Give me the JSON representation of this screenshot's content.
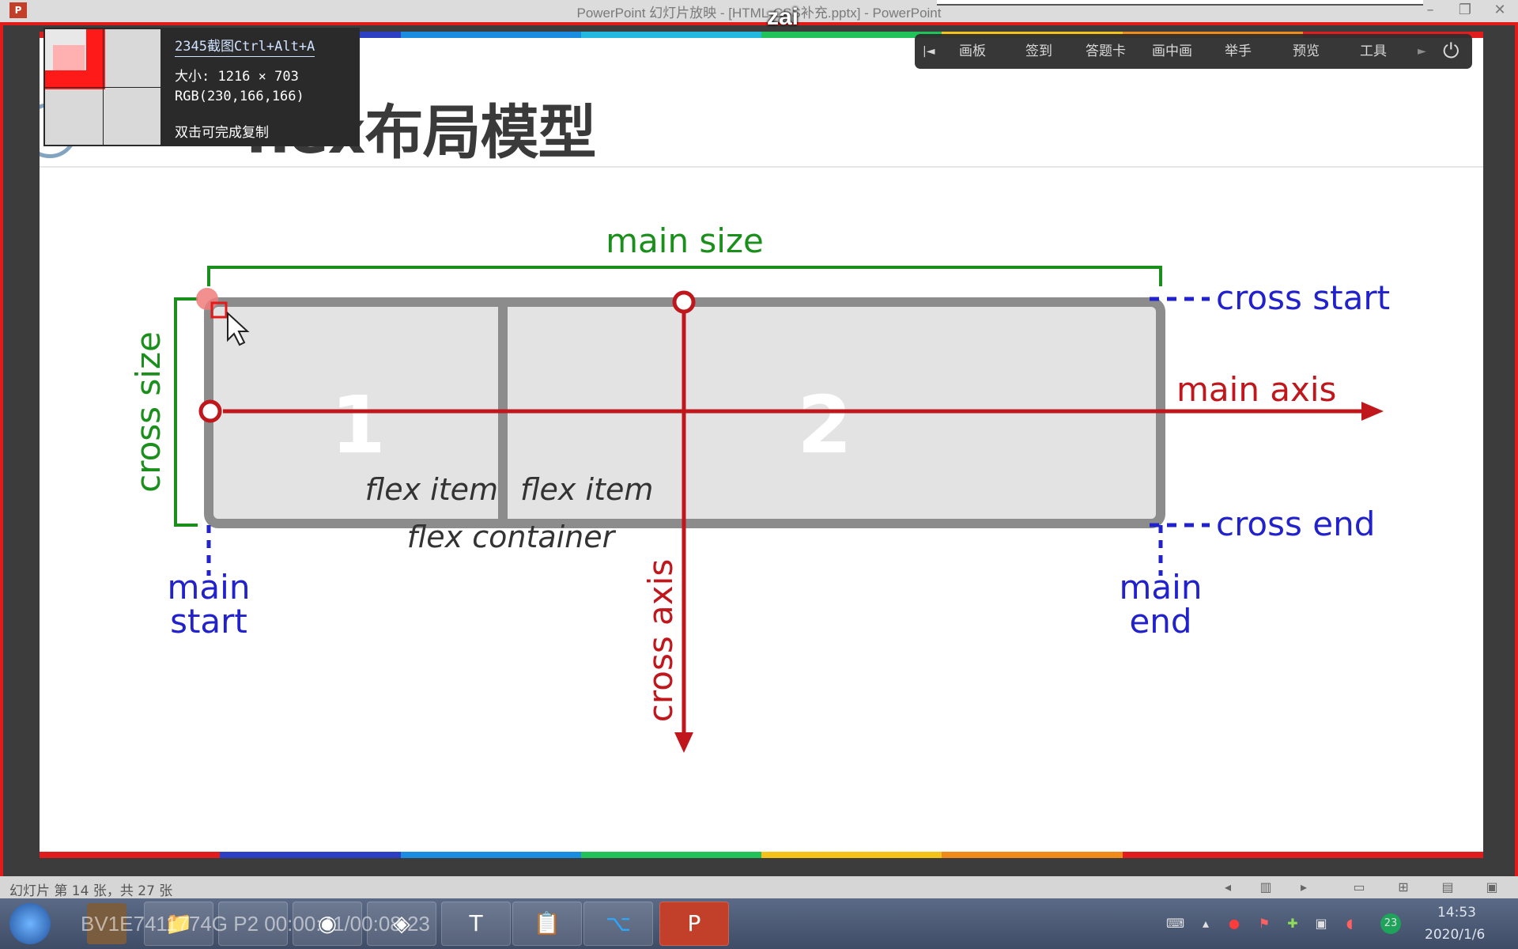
{
  "window": {
    "title": "PowerPoint 幻灯片放映 - [HTML-CSS补充.pptx] - PowerPoint",
    "app_icon": "P",
    "controls": [
      "–",
      "❐",
      "✕"
    ]
  },
  "subtitle": "zai",
  "slide": {
    "title": "flex布局模型",
    "diagram": {
      "main_size": "main size",
      "cross_size": "cross size",
      "cross_start": "cross start",
      "cross_end": "cross end",
      "main_axis": "main axis",
      "cross_axis": "cross axis",
      "main_start": [
        "main",
        "start"
      ],
      "main_end": [
        "main",
        "end"
      ],
      "item1_number": "1",
      "item2_number": "2",
      "flex_item_1": "flex item",
      "flex_item_2": "flex item",
      "flex_container": "flex container",
      "colors": {
        "green": "#1b8f1b",
        "blue": "#2222cc",
        "red": "#c0171c",
        "box_fill": "#e3e3e3",
        "box_stroke": "#8c8c8c"
      }
    }
  },
  "show_toolbar": {
    "items": [
      "画板",
      "签到",
      "答题卡",
      "画中画",
      "举手",
      "预览",
      "工具"
    ],
    "prev_icon": "|◄",
    "next_icon": "►",
    "power_icon": "⏻"
  },
  "capture_popup": {
    "hotkey": "2345截图Ctrl+Alt+A",
    "size": "大小: 1216 × 703",
    "rgb": "RGB(230,166,166)",
    "hint": "双击可完成复制"
  },
  "statusbar": {
    "text": "幻灯片 第 14 张，共 27 张"
  },
  "taskbar": {
    "video_overlay": "BV1E7411774G P2 00:00:41/00:08:23",
    "apps": [
      "folder",
      "chrome",
      "vscode-alt",
      "typora",
      "notes",
      "vscode",
      "powerpoint"
    ],
    "app_glyphs": [
      "📁",
      "◉",
      "◈",
      "T",
      "📋",
      "⌥",
      "P"
    ],
    "clock_time": "14:53",
    "clock_date": "2020/1/6",
    "tray_badge": "23"
  }
}
